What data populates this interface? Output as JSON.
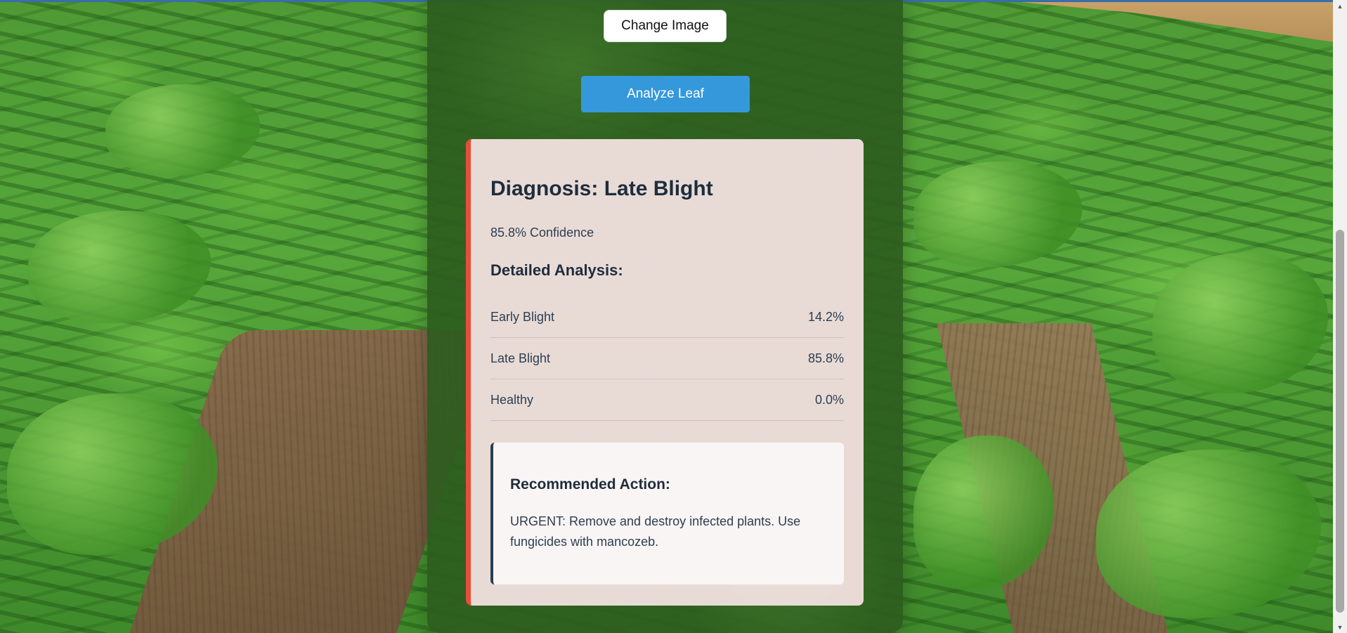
{
  "buttons": {
    "change_image": "Change Image",
    "analyze_leaf": "Analyze Leaf"
  },
  "result": {
    "diagnosis_title": "Diagnosis: Late Blight",
    "confidence_text": "85.8% Confidence",
    "analysis_heading": "Detailed Analysis:",
    "probabilities": [
      {
        "label": "Early Blight",
        "value": "14.2%"
      },
      {
        "label": "Late Blight",
        "value": "85.8%"
      },
      {
        "label": "Healthy",
        "value": "0.0%"
      }
    ],
    "recommendation": {
      "heading": "Recommended Action:",
      "text": "URGENT: Remove and destroy infected plants. Use fungicides with mancozeb."
    }
  },
  "colors": {
    "analyze_button": "#3498db",
    "diagnosis_accent": "#e74c3c",
    "card_background": "#f6e4e4",
    "text_dark": "#2c3e50"
  },
  "icons": {
    "scroll_up": "chevron-up-icon",
    "scroll_down": "chevron-down-icon"
  }
}
